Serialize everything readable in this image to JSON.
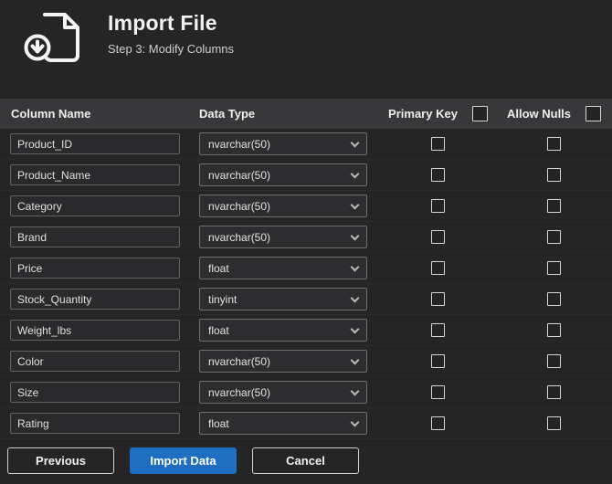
{
  "header": {
    "title": "Import File",
    "subtitle": "Step 3: Modify Columns"
  },
  "table": {
    "headers": {
      "column_name": "Column Name",
      "data_type": "Data Type",
      "primary_key": "Primary Key",
      "allow_nulls": "Allow Nulls"
    },
    "header_checkboxes": {
      "primary_key_checked": false,
      "allow_nulls_checked": false
    },
    "rows": [
      {
        "name": "Product_ID",
        "type": "nvarchar(50)",
        "primary_key": false,
        "allow_nulls": false
      },
      {
        "name": "Product_Name",
        "type": "nvarchar(50)",
        "primary_key": false,
        "allow_nulls": false
      },
      {
        "name": "Category",
        "type": "nvarchar(50)",
        "primary_key": false,
        "allow_nulls": false
      },
      {
        "name": "Brand",
        "type": "nvarchar(50)",
        "primary_key": false,
        "allow_nulls": false
      },
      {
        "name": "Price",
        "type": "float",
        "primary_key": false,
        "allow_nulls": false
      },
      {
        "name": "Stock_Quantity",
        "type": "tinyint",
        "primary_key": false,
        "allow_nulls": false
      },
      {
        "name": "Weight_lbs",
        "type": "float",
        "primary_key": false,
        "allow_nulls": false
      },
      {
        "name": "Color",
        "type": "nvarchar(50)",
        "primary_key": false,
        "allow_nulls": false
      },
      {
        "name": "Size",
        "type": "nvarchar(50)",
        "primary_key": false,
        "allow_nulls": false
      },
      {
        "name": "Rating",
        "type": "float",
        "primary_key": false,
        "allow_nulls": false
      }
    ]
  },
  "footer": {
    "previous_label": "Previous",
    "import_label": "Import Data",
    "cancel_label": "Cancel"
  },
  "colors": {
    "background": "#252526",
    "table_header": "#38383b",
    "accent_blue": "#1e6fc2"
  }
}
